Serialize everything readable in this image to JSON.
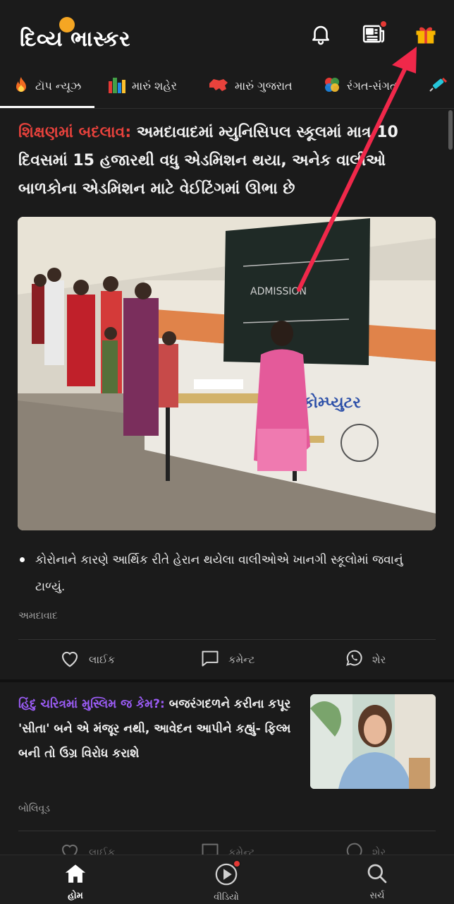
{
  "header": {
    "logo_text": "દિવ્ય ભાસ્કર"
  },
  "tabs": [
    {
      "label": "ટૉપ ન્યૂઝ",
      "icon": "flame-icon"
    },
    {
      "label": "મારું શહેર",
      "icon": "city-icon"
    },
    {
      "label": "મારું ગુજરાત",
      "icon": "gujarat-map-icon"
    },
    {
      "label": "રંગત-સંગત",
      "icon": "color-wheel-icon"
    }
  ],
  "lead_story": {
    "kicker": "શિક્ષણમાં બદલાવ:",
    "title": "અમદાવાદમાં મ્યુનિસિપલ સ્કૂલમાં માત્ર 10 દિવસમાં 15 હજારથી વધુ એડમિશન થયા, અનેક વાલીઓ બાળકોના એડમિશન માટે વેઈટિંગમાં ઊભા છે",
    "bullet": "કોરોનાને કારણે આર્થિક રીતે હેરાન થયેલા વાલીઓએ ખાનગી સ્કૂલોમાં જવાનું ટાળ્યું.",
    "category": "અમદાવાદ",
    "image_wall_text": "કોમ્પ્યુટર"
  },
  "actions": {
    "like": "લાઈક",
    "comment": "કમેન્ટ",
    "share": "શેર"
  },
  "story2": {
    "kicker": "હિંદુ ચરિત્રમાં મુસ્લિમ જ કેમ?:",
    "title": "બજરંગદળને કરીના કપૂર 'સીતા' બને એ મંજૂર નથી, આવેદન આપીને કહ્યું- ફિલ્મ બની તો ઉગ્ર વિરોધ કરાશે",
    "category": "બોલિવૂડ"
  },
  "bottom_nav": {
    "home": "હોમ",
    "video": "વીડિયો",
    "search": "સર્ચ"
  },
  "colors": {
    "background": "#1b1b1b",
    "kicker_red": "#e8423c",
    "kicker_purple": "#9b5cf6",
    "annotation_arrow": "#f0284a",
    "notification_dot": "#e53935"
  }
}
